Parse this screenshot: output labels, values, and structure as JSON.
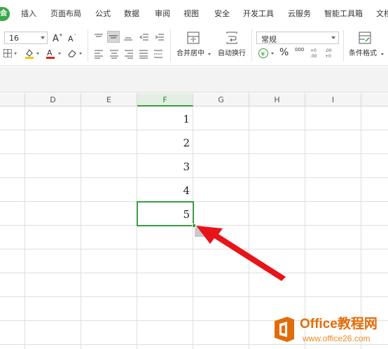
{
  "menu": {
    "start_label": "会",
    "items": [
      {
        "label": "插入"
      },
      {
        "label": "页面布局"
      },
      {
        "label": "公式"
      },
      {
        "label": "数据"
      },
      {
        "label": "审阅"
      },
      {
        "label": "视图"
      },
      {
        "label": "安全"
      },
      {
        "label": "开发工具"
      },
      {
        "label": "云服务"
      },
      {
        "label": "智能工具箱"
      },
      {
        "label": "文档"
      }
    ]
  },
  "ribbon": {
    "font_size": "16",
    "merge_center_label": "合并居中",
    "wrap_text_label": "自动换行",
    "number_format": "常规",
    "percent_symbol": "%",
    "thousands_symbol": "000",
    "cond_format_label": "条件格式",
    "colors": {
      "font_color": "#e02020",
      "fill_color": "#f5c400",
      "accent": "#3a9c3f"
    }
  },
  "grid": {
    "columns": [
      "D",
      "E",
      "F",
      "G",
      "H",
      "I"
    ],
    "active_column": "F",
    "cells_f": [
      "1",
      "2",
      "3",
      "4",
      "5"
    ],
    "selected_cell_value": "5"
  },
  "watermark": {
    "title": "Office教程网",
    "url": "www.office26.com"
  }
}
